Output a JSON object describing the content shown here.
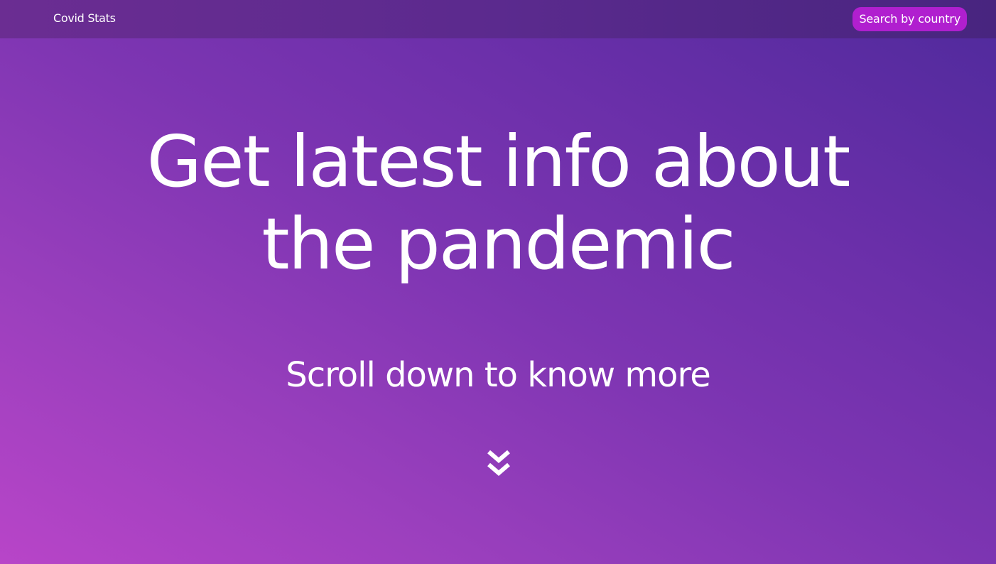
{
  "navbar": {
    "brand": "Covid Stats",
    "search_button_label": "Search by country"
  },
  "hero": {
    "title_line1": "Get latest info about",
    "title_line2": "the pandemic",
    "subtitle": "Scroll down to know more",
    "scroll_icon": "double-chevron-down-icon"
  },
  "colors": {
    "gradient_start": "#b845c8",
    "gradient_end": "#4f2a9c",
    "navbar": "#5b2a8e",
    "search_button": "#b01fcf",
    "text": "#ffffff"
  }
}
